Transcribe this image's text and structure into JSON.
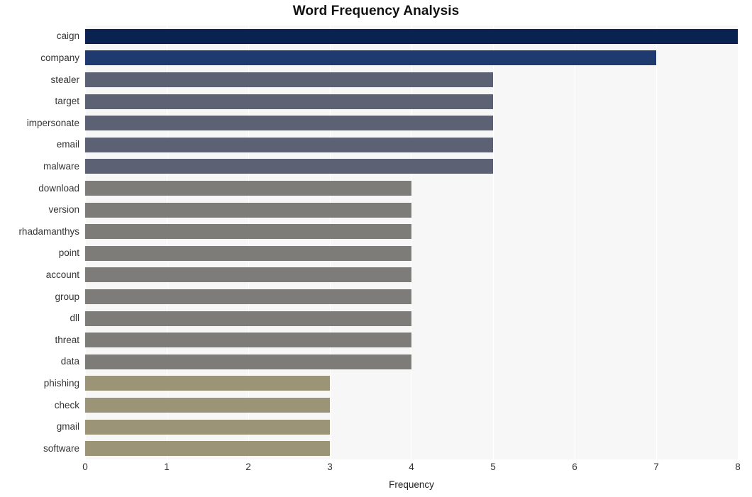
{
  "chart_data": {
    "type": "bar",
    "orientation": "horizontal",
    "title": "Word Frequency Analysis",
    "xlabel": "Frequency",
    "ylabel": "",
    "categories": [
      "caign",
      "company",
      "stealer",
      "target",
      "impersonate",
      "email",
      "malware",
      "download",
      "version",
      "rhadamanthys",
      "point",
      "account",
      "group",
      "dll",
      "threat",
      "data",
      "phishing",
      "check",
      "gmail",
      "software"
    ],
    "values": [
      8,
      7,
      5,
      5,
      5,
      5,
      5,
      4,
      4,
      4,
      4,
      4,
      4,
      4,
      4,
      4,
      3,
      3,
      3,
      3
    ],
    "bar_colors": [
      "#0a2250",
      "#1f3a6e",
      "#5c6273",
      "#5c6273",
      "#5c6273",
      "#5c6273",
      "#5c6273",
      "#7d7c79",
      "#7d7c79",
      "#7d7c79",
      "#7d7c79",
      "#7d7c79",
      "#7d7c79",
      "#7d7c79",
      "#7d7c79",
      "#7d7c79",
      "#9b9477",
      "#9b9477",
      "#9b9477",
      "#9b9477"
    ],
    "xlim": [
      0,
      8
    ],
    "xticks": [
      0,
      1,
      2,
      3,
      4,
      5,
      6,
      7,
      8
    ],
    "xtick_labels": [
      "0",
      "1",
      "2",
      "3",
      "4",
      "5",
      "6",
      "7",
      "8"
    ],
    "grid": true,
    "grid_axis": "x",
    "grid_color": "#ffffff",
    "plot_background": "#f7f7f7",
    "figure_background": "#ffffff",
    "legend": null
  }
}
